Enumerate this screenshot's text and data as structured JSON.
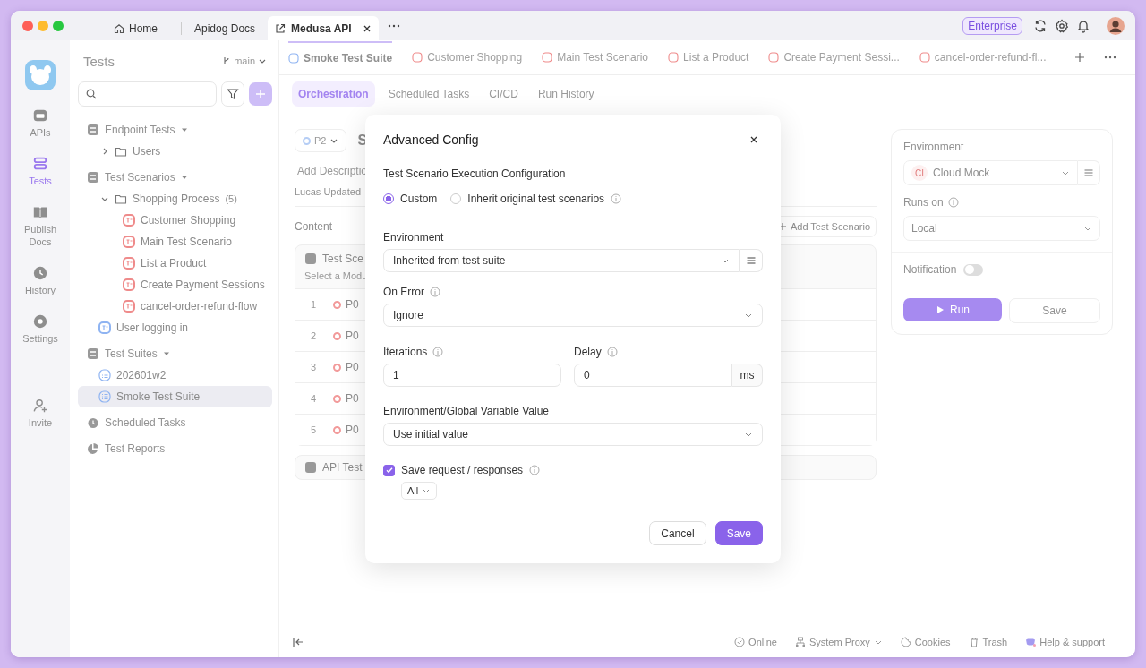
{
  "app_tabs": [
    {
      "label": "Home",
      "selected": false
    },
    {
      "label": "Apidog Docs",
      "selected": false
    },
    {
      "label": "Medusa API",
      "selected": true
    }
  ],
  "plan_badge": "Enterprise",
  "nav": [
    {
      "label": "APIs",
      "selected": false
    },
    {
      "label": "Tests",
      "selected": true
    },
    {
      "label": "Publish Docs",
      "selected": false
    },
    {
      "label": "History",
      "selected": false
    },
    {
      "label": "Settings",
      "selected": false
    },
    {
      "label": "Invite",
      "selected": false
    }
  ],
  "tree": {
    "title": "Tests",
    "branch": "main",
    "items": [
      {
        "label": "Endpoint Tests",
        "kind": "group",
        "expanded": true,
        "selected": false,
        "children": [
          {
            "label": "Users",
            "kind": "folder",
            "expanded": false,
            "selected": false
          }
        ]
      },
      {
        "label": "Test Scenarios",
        "kind": "group",
        "expanded": true,
        "selected": false,
        "children": [
          {
            "label": "Shopping Process",
            "count": "(5)",
            "kind": "folder",
            "expanded": true,
            "selected": false,
            "children": [
              {
                "label": "Customer Shopping",
                "kind": "scenario",
                "color": "#ef8b8b",
                "selected": false
              },
              {
                "label": "Main Test Scenario",
                "kind": "scenario",
                "color": "#ef8b8b",
                "selected": false
              },
              {
                "label": "List a Product",
                "kind": "scenario",
                "color": "#ef8b8b",
                "selected": false
              },
              {
                "label": "Create Payment Sessions",
                "kind": "scenario",
                "color": "#ef8b8b",
                "selected": false
              },
              {
                "label": "cancel-order-refund-flow",
                "kind": "scenario",
                "color": "#ef8b8b",
                "selected": false
              }
            ]
          },
          {
            "label": "User logging in",
            "kind": "scenario",
            "color": "#8fb4f2",
            "selected": false
          }
        ]
      },
      {
        "label": "Test Suites",
        "kind": "group",
        "expanded": true,
        "selected": false,
        "children": [
          {
            "label": "202601w2",
            "kind": "suite",
            "selected": false
          },
          {
            "label": "Smoke Test Suite",
            "kind": "suite",
            "selected": true
          }
        ]
      },
      {
        "label": "Scheduled Tasks",
        "kind": "link",
        "selected": false
      },
      {
        "label": "Test Reports",
        "kind": "link",
        "selected": false
      }
    ]
  },
  "editor_tabs": [
    {
      "label": "Smoke Test Suite",
      "kind": "suite",
      "selected": true
    },
    {
      "label": "Customer Shopping",
      "kind": "scenario",
      "selected": false
    },
    {
      "label": "Main Test Scenario",
      "kind": "scenario",
      "selected": false
    },
    {
      "label": "List a Product",
      "kind": "scenario",
      "selected": false
    },
    {
      "label": "Create Payment Sessi...",
      "kind": "scenario",
      "selected": false
    },
    {
      "label": "cancel-order-refund-fl...",
      "kind": "scenario",
      "selected": false
    }
  ],
  "sub_tabs": [
    {
      "label": "Orchestration",
      "selected": true
    },
    {
      "label": "Scheduled Tasks",
      "selected": false
    },
    {
      "label": "CI/CD",
      "selected": false
    },
    {
      "label": "Run History",
      "selected": false
    }
  ],
  "suite": {
    "priority": "P2",
    "title": "S",
    "description_placeholder": "Add Descriptio",
    "meta": "Lucas Updated",
    "content_label": "Content",
    "add_button": "Add Test Scenario",
    "scenario_card": {
      "title": "Test Sce",
      "hint": "Select a Modu"
    },
    "rows": [
      {
        "index": "1",
        "priority": "P0",
        "color": "#f29a9a"
      },
      {
        "index": "2",
        "priority": "P0",
        "color": "#f29a9a"
      },
      {
        "index": "3",
        "priority": "P0",
        "color": "#f29a9a"
      },
      {
        "index": "4",
        "priority": "P0",
        "color": "#f29a9a"
      },
      {
        "index": "5",
        "priority": "P0",
        "color": "#f29a9a"
      }
    ],
    "api_card": "API Test"
  },
  "run_panel": {
    "environment_label": "Environment",
    "environment_badge": "CI",
    "environment": "Cloud Mock",
    "runs_on_label": "Runs on",
    "runs_on": "Local",
    "notification_label": "Notification",
    "notification_on": false,
    "run_button": "Run",
    "save_button": "Save"
  },
  "status_bar": [
    "Online",
    "System Proxy",
    "Cookies",
    "Trash",
    "Help & support"
  ],
  "dialog": {
    "title": "Advanced Config",
    "section": "Test Scenario Execution Configuration",
    "modes": [
      {
        "label": "Custom",
        "selected": true
      },
      {
        "label": "Inherit original test scenarios",
        "selected": false
      }
    ],
    "environment_label": "Environment",
    "environment": "Inherited from test suite",
    "on_error_label": "On Error",
    "on_error": "Ignore",
    "iterations_label": "Iterations",
    "iterations": "1",
    "delay_label": "Delay",
    "delay": "0",
    "delay_unit": "ms",
    "variable_label": "Environment/Global Variable Value",
    "variable": "Use initial value",
    "save_responses": {
      "label": "Save request / responses",
      "checked": true,
      "scope": "All"
    },
    "cancel_button": "Cancel",
    "save_button": "Save"
  }
}
